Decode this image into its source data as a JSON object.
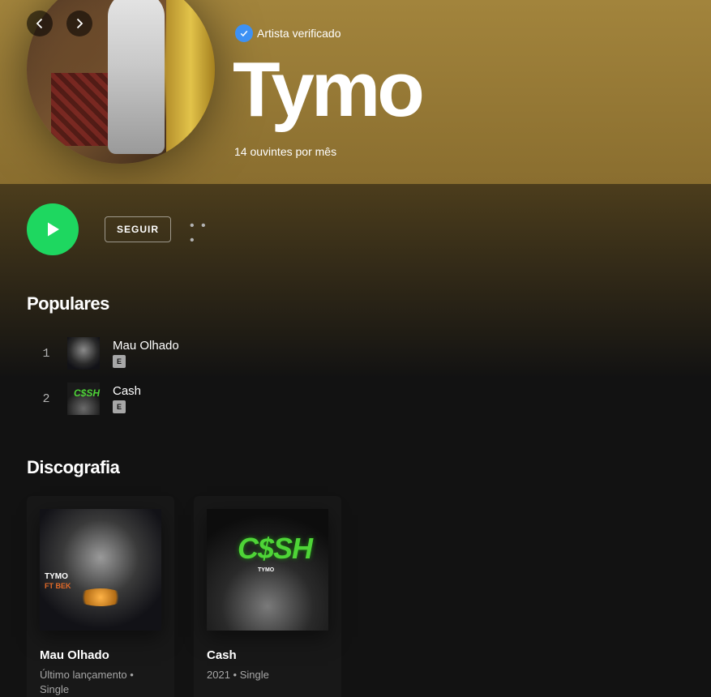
{
  "header": {
    "verified_label": "Artista verificado",
    "artist_name": "Tymo",
    "monthly_listeners": "14 ouvintes por mês"
  },
  "actions": {
    "follow_label": "SEGUIR",
    "more_label": "• • •"
  },
  "popular": {
    "title": "Populares",
    "tracks": [
      {
        "number": "1",
        "title": "Mau Olhado",
        "explicit": "E"
      },
      {
        "number": "2",
        "title": "Cash",
        "explicit": "E"
      }
    ]
  },
  "discography": {
    "title": "Discografia",
    "items": [
      {
        "title": "Mau Olhado",
        "subtitle": "Último lançamento • Single",
        "cover_text": "TYMO",
        "cover_text2": "FT BEK"
      },
      {
        "title": "Cash",
        "subtitle": "2021 • Single",
        "cover_text": "C$SH",
        "cover_text2": "TYMO"
      }
    ]
  },
  "colors": {
    "hero": "#a2843c",
    "play": "#1ed760",
    "verified_badge": "#3d91f4",
    "background": "#121212"
  },
  "icons": [
    "chevron-left-icon",
    "chevron-right-icon",
    "verified-check-icon",
    "play-icon"
  ]
}
